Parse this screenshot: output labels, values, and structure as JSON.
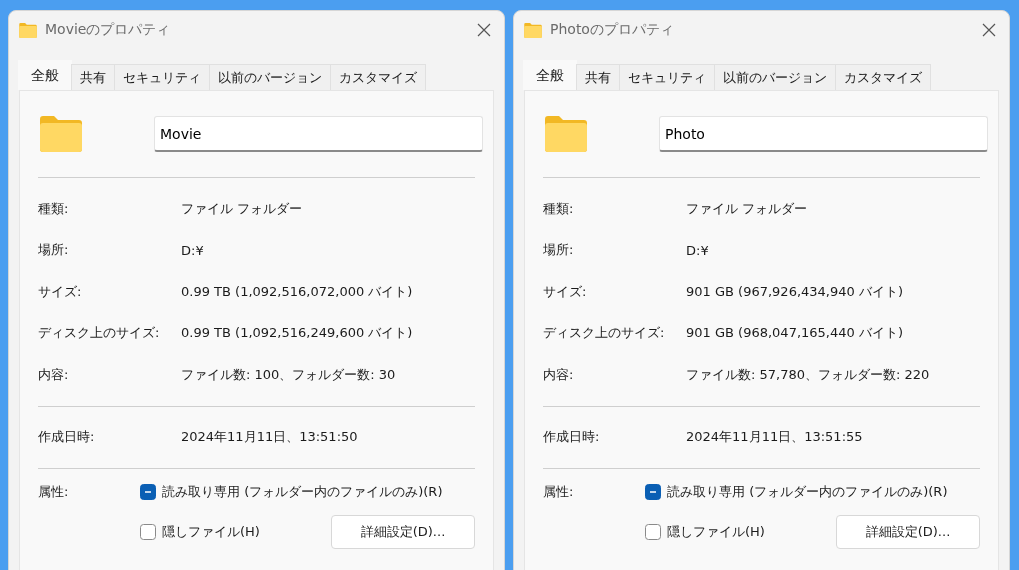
{
  "dialogs": [
    {
      "title": "Movieのプロパティ",
      "tabs": [
        {
          "label": "全般",
          "selected": true
        },
        {
          "label": "共有",
          "selected": false
        },
        {
          "label": "セキュリティ",
          "selected": false
        },
        {
          "label": "以前のバージョン",
          "selected": false
        },
        {
          "label": "カスタマイズ",
          "selected": false
        }
      ],
      "name": "Movie",
      "groups": [
        [
          {
            "label": "種類:",
            "value": "ファイル フォルダー"
          },
          {
            "label": "場所:",
            "value": "D:¥"
          },
          {
            "label": "サイズ:",
            "value": "0.99 TB (1,092,516,072,000 バイト)"
          },
          {
            "label": "ディスク上のサイズ:",
            "value": "0.99 TB (1,092,516,249,600 バイト)"
          },
          {
            "label": "内容:",
            "value": "ファイル数: 100、フォルダー数: 30"
          }
        ],
        [
          {
            "label": "作成日時:",
            "value": "2024年11月11日、13:51:50"
          }
        ]
      ],
      "attributes_label": "属性:",
      "attributes": [
        {
          "label": "読み取り専用 (フォルダー内のファイルのみ)(R)",
          "checked": false,
          "indeterminate": true
        },
        {
          "label": "隠しファイル(H)",
          "checked": false,
          "indeterminate": false
        }
      ],
      "advanced_button": "詳細設定(D)..."
    },
    {
      "title": "Photoのプロパティ",
      "tabs": [
        {
          "label": "全般",
          "selected": true
        },
        {
          "label": "共有",
          "selected": false
        },
        {
          "label": "セキュリティ",
          "selected": false
        },
        {
          "label": "以前のバージョン",
          "selected": false
        },
        {
          "label": "カスタマイズ",
          "selected": false
        }
      ],
      "name": "Photo",
      "groups": [
        [
          {
            "label": "種類:",
            "value": "ファイル フォルダー"
          },
          {
            "label": "場所:",
            "value": "D:¥"
          },
          {
            "label": "サイズ:",
            "value": "901 GB (967,926,434,940 バイト)"
          },
          {
            "label": "ディスク上のサイズ:",
            "value": "901 GB (968,047,165,440 バイト)"
          },
          {
            "label": "内容:",
            "value": "ファイル数: 57,780、フォルダー数: 220"
          }
        ],
        [
          {
            "label": "作成日時:",
            "value": "2024年11月11日、13:51:55"
          }
        ]
      ],
      "attributes_label": "属性:",
      "attributes": [
        {
          "label": "読み取り専用 (フォルダー内のファイルのみ)(R)",
          "checked": false,
          "indeterminate": true
        },
        {
          "label": "隠しファイル(H)",
          "checked": false,
          "indeterminate": false
        }
      ],
      "advanced_button": "詳細設定(D)..."
    }
  ]
}
